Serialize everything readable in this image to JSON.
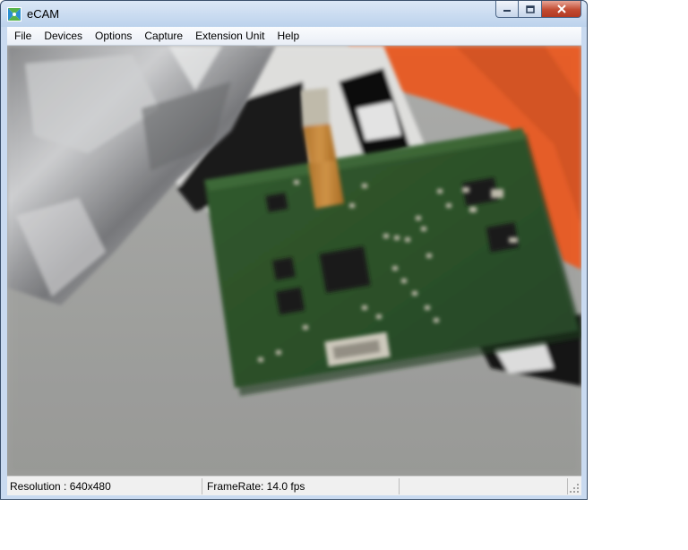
{
  "window": {
    "title": "eCAM"
  },
  "menu": {
    "items": [
      {
        "label": "File",
        "name": "menu-file"
      },
      {
        "label": "Devices",
        "name": "menu-devices"
      },
      {
        "label": "Options",
        "name": "menu-options"
      },
      {
        "label": "Capture",
        "name": "menu-capture"
      },
      {
        "label": "Extension Unit",
        "name": "menu-extension-unit"
      },
      {
        "label": "Help",
        "name": "menu-help"
      }
    ]
  },
  "status": {
    "resolution": "Resolution : 640x480",
    "framerate": "FrameRate: 14.0 fps",
    "empty": ""
  },
  "icons": {
    "app": "ecam-app-icon",
    "minimize": "minimize-icon",
    "maximize": "maximize-icon",
    "close": "close-icon",
    "grip": "resize-grip-icon"
  },
  "colors": {
    "titlebar": "#c9daf0",
    "close_button": "#c24b32",
    "pcb_green": "#2f5a2a",
    "orange_tape": "#f0622a"
  }
}
